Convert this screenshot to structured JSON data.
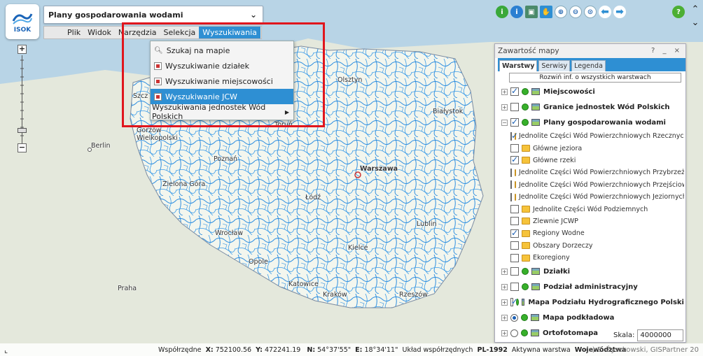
{
  "app": {
    "logo_text": "ISOK",
    "combo_title": "Plany gospodarowania wodami"
  },
  "menubar": {
    "items": [
      {
        "label": "Plik",
        "active": false
      },
      {
        "label": "Widok",
        "active": false
      },
      {
        "label": "Narzędzia",
        "active": false
      },
      {
        "label": "Selekcja",
        "active": false
      },
      {
        "label": "Wyszukiwania",
        "active": true
      }
    ]
  },
  "dropdown": {
    "items": [
      {
        "label": "Szukaj na mapie",
        "icon": "magnifier-icon",
        "selected": false
      },
      {
        "label": "Wyszukiwanie działek",
        "icon": "search-form-icon",
        "selected": false
      },
      {
        "label": "Wyszukiwanie miejscowości",
        "icon": "search-form-icon",
        "selected": false
      },
      {
        "label": "Wyszukiwanie JCW",
        "icon": "search-form-icon",
        "selected": true
      },
      {
        "label": "Wyszukiwania jednostek Wód Polskich",
        "icon": "submenu-arrow-icon",
        "selected": false
      }
    ]
  },
  "toolbar": {
    "icons": [
      "info-green-icon",
      "info-blue-icon",
      "identify-icon",
      "pan-hand-icon",
      "zoom-in-icon",
      "zoom-out-icon",
      "zoom-extent-icon",
      "back-arrow-icon",
      "forward-arrow-icon"
    ],
    "help_label": "?"
  },
  "panel": {
    "title": "Zawartość mapy",
    "controls": "? _ ×",
    "tabs": [
      {
        "label": "Warstwy",
        "active": true
      },
      {
        "label": "Serwisy",
        "active": false
      },
      {
        "label": "Legenda",
        "active": false
      }
    ],
    "expand_all": "Rozwiń inf. o wszystkich warstwach",
    "rows": [
      {
        "label": "Miejscowości",
        "level": 0,
        "checked": true,
        "expander": "+",
        "bold": true
      },
      {
        "label": "Granice jednostek Wód Polskich",
        "level": 0,
        "checked": false,
        "expander": "+",
        "bold": true
      },
      {
        "label": "Plany gospodarowania wodami",
        "level": 0,
        "checked": true,
        "expander": "−",
        "bold": true
      },
      {
        "label": "Jednolite Części Wód Powierzchniowych Rzecznych",
        "level": 1,
        "checked": true
      },
      {
        "label": "Główne jeziora",
        "level": 1,
        "checked": false
      },
      {
        "label": "Główne rzeki",
        "level": 1,
        "checked": true
      },
      {
        "label": "Jednolite Części Wód Powierzchniowych Przybrzeżnych",
        "level": 1,
        "checked": false
      },
      {
        "label": "Jednolite Części Wód Powierzchniowych Przejściowych",
        "level": 1,
        "checked": false
      },
      {
        "label": "Jednolite Części Wód Powierzchniowych Jeziornych",
        "level": 1,
        "checked": false
      },
      {
        "label": "Jednolite Części Wód Podziemnych",
        "level": 1,
        "checked": false
      },
      {
        "label": "Zlewnie JCWP",
        "level": 1,
        "checked": false
      },
      {
        "label": "Regiony Wodne",
        "level": 1,
        "checked": true
      },
      {
        "label": "Obszary Dorzeczy",
        "level": 1,
        "checked": false
      },
      {
        "label": "Ekoregiony",
        "level": 1,
        "checked": false
      },
      {
        "label": "Działki",
        "level": 0,
        "checked": false,
        "expander": "+",
        "bold": true
      },
      {
        "label": "Podział administracyjny",
        "level": 0,
        "checked": false,
        "expander": "+",
        "bold": true
      },
      {
        "label": "Mapa Podziału Hydrograficznego Polski",
        "level": 0,
        "checked": true,
        "expander": "+",
        "bold": true
      },
      {
        "label": "Mapa podkładowa",
        "level": 0,
        "radio": true,
        "checked": true,
        "expander": "+",
        "bold": true
      },
      {
        "label": "Ortofotomapa",
        "level": 0,
        "radio": true,
        "checked": false,
        "expander": "+",
        "bold": true
      }
    ],
    "scale_label": "Skala:",
    "scale_value": "4000000"
  },
  "status": {
    "coords_label": "Współrzędne",
    "x_label": "X:",
    "x_value": "752100.56",
    "y_label": "Y:",
    "y_value": "472241.19",
    "n_label": "N:",
    "n_value": "54°37'55\"",
    "e_label": "E:",
    "e_value": "18°34'11\"",
    "system_label": "Układ współrzędnych",
    "system_value": "PL-1992",
    "active_label": "Aktywna warstwa",
    "active_value": "Województwa",
    "copyright": "(c) E. Żyszkowski, GISPartner 20"
  },
  "map": {
    "cities": [
      {
        "name": "Olsztyn"
      },
      {
        "name": "Białystok"
      },
      {
        "name": "Szcz"
      },
      {
        "name": "Toruń"
      },
      {
        "name": "Gorzów Wielkopolski"
      },
      {
        "name": "Berlin"
      },
      {
        "name": "Poznań"
      },
      {
        "name": "Warszawa"
      },
      {
        "name": "Zielona Góra"
      },
      {
        "name": "Łódź"
      },
      {
        "name": "Lublin"
      },
      {
        "name": "Wrocław"
      },
      {
        "name": "Kielce"
      },
      {
        "name": "Opole"
      },
      {
        "name": "Praha"
      },
      {
        "name": "Katowice"
      },
      {
        "name": "Kraków"
      },
      {
        "name": "Rzeszów"
      }
    ]
  }
}
